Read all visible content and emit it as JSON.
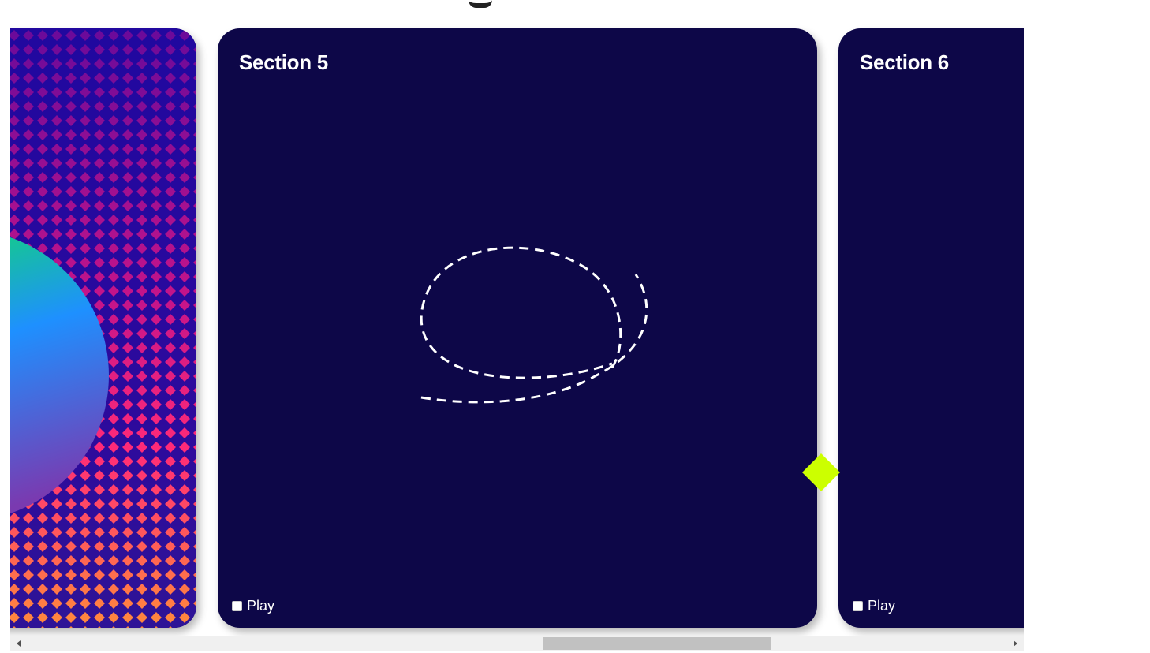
{
  "sections": [
    {
      "title": "Section 5",
      "play_label": "Play"
    },
    {
      "title": "Section 6",
      "play_label": "Play"
    }
  ],
  "colors": {
    "card_bg": "#0d0748",
    "diamond": "#ccff00",
    "pattern_top": "#7a0aa0",
    "pattern_bottom": "#ff8a3c",
    "scroll_thumb": "#c1c1c1"
  },
  "icons": {
    "scroll_left": "triangle-left-icon",
    "scroll_right": "triangle-right-icon"
  }
}
